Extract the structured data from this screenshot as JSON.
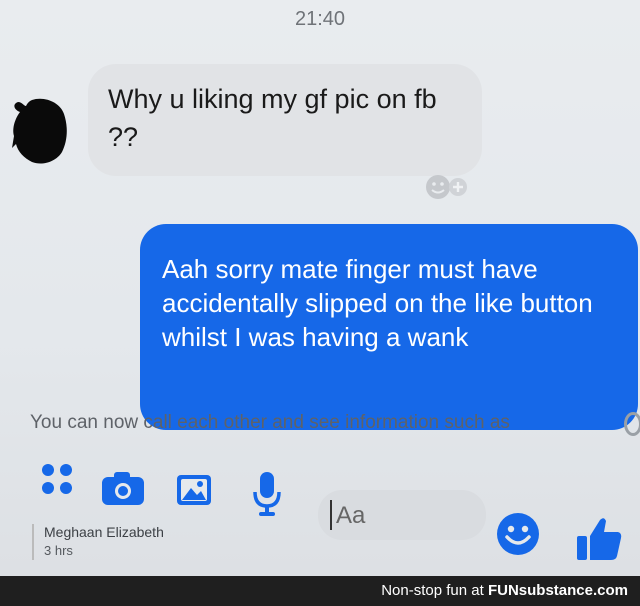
{
  "header": {
    "time": "21:40"
  },
  "conversation": {
    "incoming_message": "Why u liking my gf pic on fb ??",
    "outgoing_message": "Aah sorry mate finger must have accidentally slipped on the like button whilst I was having a wank",
    "notice": "You can now call each other and see information such as"
  },
  "composer": {
    "placeholder": "Aa",
    "icons": [
      "apps-icon",
      "camera-icon",
      "image-icon",
      "microphone-icon",
      "emoji-icon",
      "thumbs-up-icon"
    ],
    "accent_color": "#1668e8"
  },
  "notification": {
    "name": "Meghaan Elizabeth",
    "time": "3 hrs"
  },
  "watermark": {
    "prefix": "Non-stop fun at",
    "brand": "FUNsubstance.com"
  }
}
